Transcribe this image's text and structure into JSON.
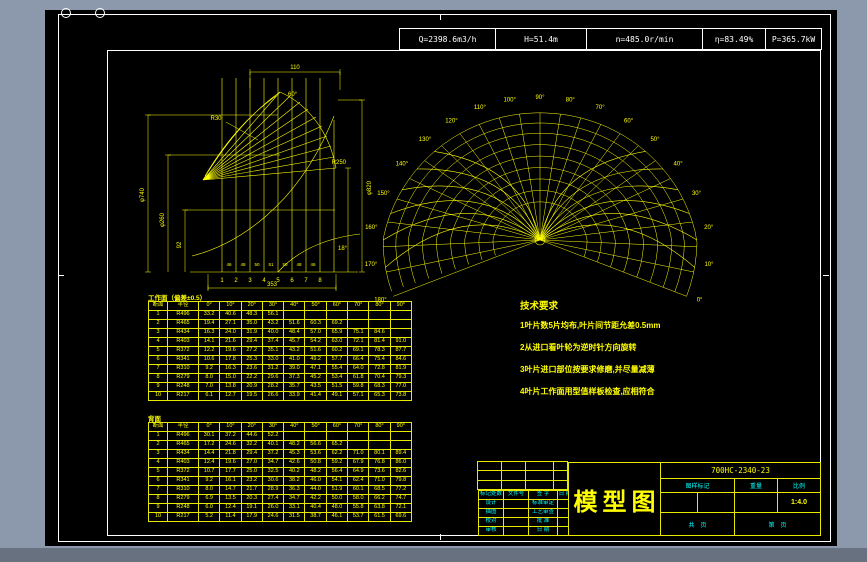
{
  "header": {
    "params": [
      "Q=2398.6m3/h",
      "H=51.4m",
      "n=485.0r/min",
      "η=83.49%",
      "P=365.7kW"
    ]
  },
  "notes": {
    "title": "技术要求",
    "items": [
      "1叶片数5片均布,叶片间节距允差0.5mm",
      "2从进口看叶轮为逆时针方向旋转",
      "3叶片进口部位按要求修磨,并尽量减薄",
      "4叶片工作面用型值样板检查,应相符合"
    ]
  },
  "colors": {
    "line": "#ffff00",
    "frame": "#ffffff",
    "label": "#00ffff",
    "paper": "#000000",
    "desktop": "#8c99ac"
  },
  "tables": {
    "working": {
      "title": "工作面（偏差±0.5）",
      "columns": [
        "断面",
        "半径",
        "0°",
        "10°",
        "20°",
        "30°",
        "40°",
        "50°",
        "60°",
        "70°",
        "80°",
        "90°"
      ],
      "rows": [
        [
          "1",
          "R496",
          "33.2",
          "40.6",
          "48.3",
          "56.1",
          "",
          "",
          "",
          "",
          "",
          ""
        ],
        [
          "2",
          "R465",
          "19.4",
          "27.1",
          "35.0",
          "43.2",
          "51.6",
          "60.3",
          "69.2",
          "",
          "",
          ""
        ],
        [
          "3",
          "R434",
          "16.3",
          "24.0",
          "31.9",
          "40.0",
          "48.4",
          "57.0",
          "65.9",
          "75.1",
          "84.6",
          ""
        ],
        [
          "4",
          "R403",
          "14.1",
          "21.6",
          "29.4",
          "37.4",
          "45.7",
          "54.2",
          "63.0",
          "72.1",
          "81.4",
          "91.0"
        ],
        [
          "5",
          "R372",
          "12.2",
          "19.6",
          "27.2",
          "35.1",
          "43.2",
          "51.6",
          "60.2",
          "69.1",
          "78.3",
          "87.7"
        ],
        [
          "6",
          "R341",
          "10.6",
          "17.8",
          "25.3",
          "33.0",
          "41.0",
          "49.2",
          "57.7",
          "66.4",
          "75.4",
          "84.6"
        ],
        [
          "7",
          "R310",
          "9.2",
          "16.3",
          "23.6",
          "31.2",
          "39.0",
          "47.1",
          "55.4",
          "64.0",
          "72.8",
          "81.9"
        ],
        [
          "8",
          "R279",
          "8.0",
          "15.0",
          "22.2",
          "29.6",
          "37.3",
          "45.2",
          "53.4",
          "61.8",
          "70.4",
          "79.3"
        ],
        [
          "9",
          "R248",
          "7.0",
          "13.8",
          "20.9",
          "28.2",
          "35.7",
          "43.5",
          "51.5",
          "59.8",
          "68.3",
          "77.0"
        ],
        [
          "10",
          "R217",
          "6.1",
          "12.7",
          "19.5",
          "26.6",
          "33.9",
          "41.4",
          "49.1",
          "57.1",
          "65.3",
          "73.8"
        ]
      ]
    },
    "back": {
      "title": "背面",
      "columns": [
        "断面",
        "半径",
        "0°",
        "10°",
        "20°",
        "30°",
        "40°",
        "50°",
        "60°",
        "70°",
        "80°",
        "90°"
      ],
      "rows": [
        [
          "1",
          "R496",
          "30.1",
          "37.2",
          "44.6",
          "52.2",
          "",
          "",
          "",
          "",
          "",
          ""
        ],
        [
          "2",
          "R465",
          "17.2",
          "24.6",
          "32.2",
          "40.1",
          "48.2",
          "56.6",
          "65.2",
          "",
          "",
          ""
        ],
        [
          "3",
          "R434",
          "14.4",
          "21.8",
          "29.4",
          "37.2",
          "45.3",
          "53.6",
          "62.2",
          "71.0",
          "80.1",
          "89.4"
        ],
        [
          "4",
          "R403",
          "12.4",
          "19.6",
          "27.0",
          "34.7",
          "42.6",
          "50.8",
          "59.2",
          "67.9",
          "76.8",
          "86.0"
        ],
        [
          "5",
          "R372",
          "10.7",
          "17.7",
          "25.0",
          "32.5",
          "40.2",
          "48.2",
          "56.4",
          "64.9",
          "73.6",
          "82.6"
        ],
        [
          "6",
          "R341",
          "9.2",
          "16.1",
          "23.2",
          "30.6",
          "38.2",
          "46.0",
          "54.1",
          "62.4",
          "71.0",
          "79.8"
        ],
        [
          "7",
          "R310",
          "8.0",
          "14.7",
          "21.7",
          "28.9",
          "36.3",
          "44.0",
          "51.9",
          "60.1",
          "68.5",
          "77.2"
        ],
        [
          "8",
          "R279",
          "6.9",
          "13.5",
          "20.3",
          "27.4",
          "34.7",
          "42.2",
          "50.0",
          "58.0",
          "66.2",
          "74.7"
        ],
        [
          "9",
          "R248",
          "6.0",
          "12.4",
          "19.1",
          "26.0",
          "33.1",
          "40.4",
          "48.0",
          "55.8",
          "63.8",
          "72.1"
        ],
        [
          "10",
          "R217",
          "5.2",
          "11.4",
          "17.9",
          "24.6",
          "31.5",
          "38.7",
          "46.1",
          "53.7",
          "61.5",
          "69.6"
        ]
      ]
    }
  },
  "meridional": {
    "dim_top": "110",
    "dim_bottom": "353",
    "dim_left_outer": "φ740",
    "dim_left_mid": "φ260",
    "dim_left_inner": "92",
    "dim_right_outer": "φ820",
    "radius_leader": "R250",
    "radius_small": "R30",
    "angle_top": "60°",
    "angle_bottom": "18°",
    "section_numbers": [
      "1",
      "2",
      "3",
      "4",
      "5",
      "6",
      "7",
      "8"
    ],
    "thickness": [
      "46",
      "48",
      "50",
      "51",
      "50",
      "48",
      "46"
    ]
  },
  "plan_view": {
    "labels": [
      "0°",
      "10°",
      "20°",
      "30°",
      "40°",
      "50°",
      "60°",
      "70°",
      "80°",
      "90°",
      "100°",
      "110°",
      "120°",
      "130°",
      "140°",
      "150°",
      "160°",
      "170°",
      "180°"
    ]
  },
  "title_block": {
    "drawing_title": "模型图",
    "part_no": "700HC-2340-23",
    "col_labels": [
      "图样标记",
      "重量",
      "比例"
    ],
    "scale": "1:4.0",
    "sheet_total": "共　页",
    "sheet_no": "第　页",
    "left": {
      "columns": [
        "标记处数",
        "文件号",
        "签 字",
        "日 期"
      ],
      "rows": [
        [
          "设计",
          "",
          "标准审定",
          ""
        ],
        [
          "描图",
          "",
          "工艺审查",
          ""
        ],
        [
          "校对",
          "",
          "批 准",
          ""
        ],
        [
          "审核",
          "",
          "日 期",
          ""
        ]
      ]
    }
  }
}
